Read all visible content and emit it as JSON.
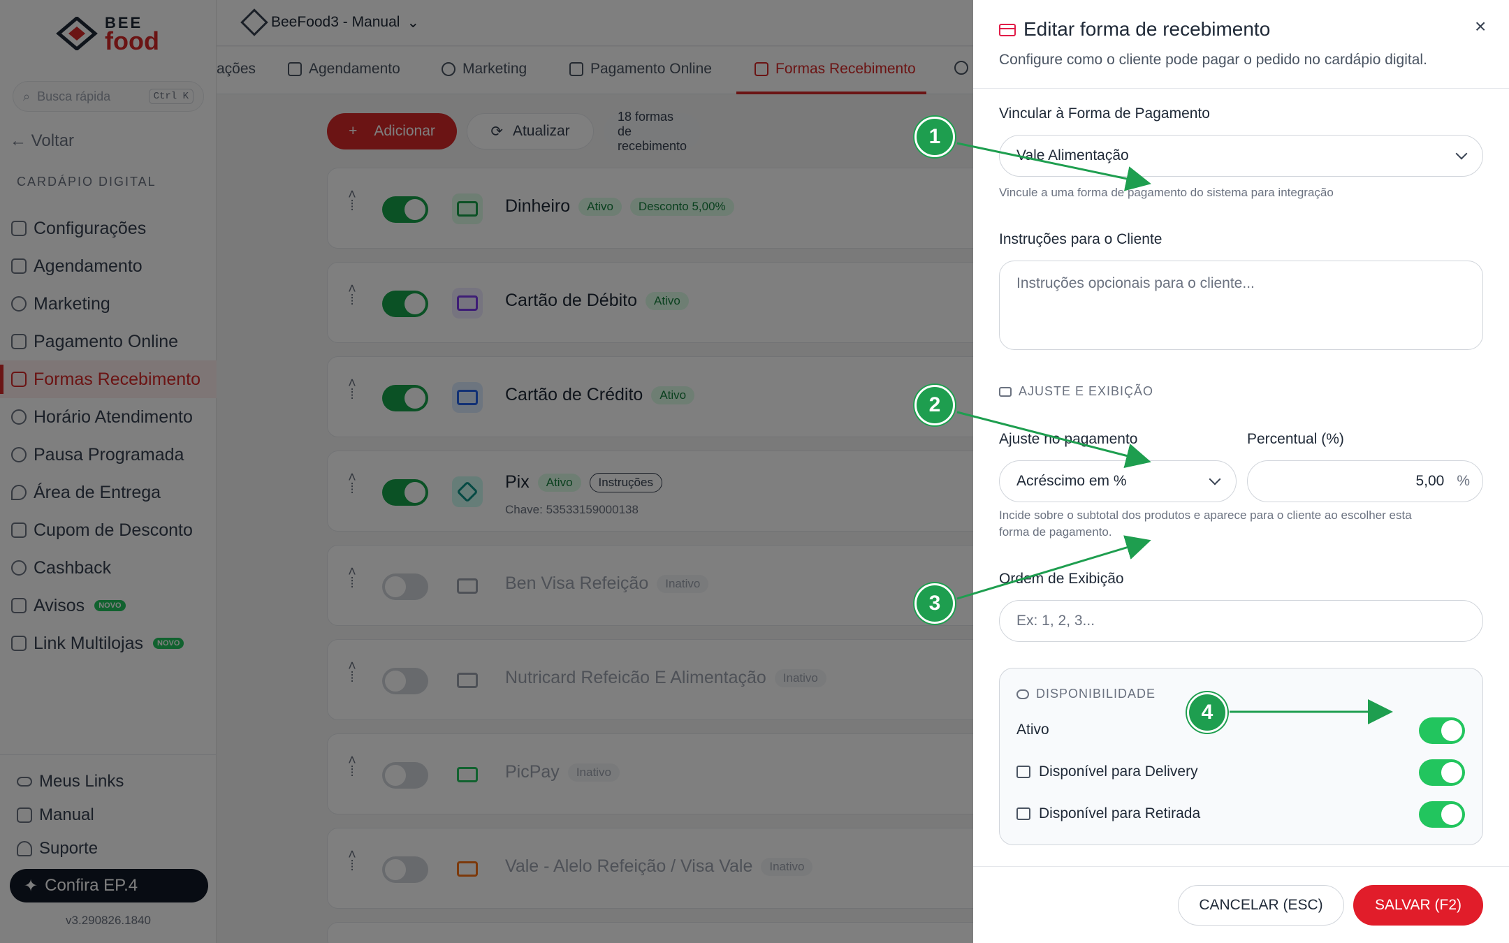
{
  "sidebar": {
    "logo_top": "BEE",
    "logo_bottom": "food",
    "search_placeholder": "Busca rápida",
    "search_shortcut": "Ctrl K",
    "back_label": "Voltar",
    "section_title": "CARDÁPIO DIGITAL",
    "items": [
      {
        "label": "Configurações",
        "icon": "gear-icon"
      },
      {
        "label": "Agendamento",
        "icon": "calendar-icon"
      },
      {
        "label": "Marketing",
        "icon": "target-icon"
      },
      {
        "label": "Pagamento Online",
        "icon": "card-icon"
      },
      {
        "label": "Formas Recebimento",
        "icon": "receipt-icon"
      },
      {
        "label": "Horário Atendimento",
        "icon": "clock-icon"
      },
      {
        "label": "Pausa Programada",
        "icon": "pause-icon"
      },
      {
        "label": "Área de Entrega",
        "icon": "map-pin-icon"
      },
      {
        "label": "Cupom de Desconto",
        "icon": "ticket-icon"
      },
      {
        "label": "Cashback",
        "icon": "coins-icon"
      },
      {
        "label": "Avisos",
        "icon": "megaphone-icon",
        "badge": "NOVO"
      },
      {
        "label": "Link Multilojas",
        "icon": "store-icon",
        "badge": "NOVO"
      }
    ],
    "bottom_items": [
      {
        "label": "Meus Links",
        "icon": "link-icon"
      },
      {
        "label": "Manual",
        "icon": "book-icon"
      },
      {
        "label": "Suporte",
        "icon": "headset-icon"
      }
    ],
    "confira_label": "Confira EP.4",
    "version": "v3.290826.1840"
  },
  "topbar": {
    "store_name": "BeeFood3 - Manual"
  },
  "tabs": [
    {
      "label": "ações",
      "icon": ""
    },
    {
      "label": "Agendamento",
      "icon": "calendar-icon"
    },
    {
      "label": "Marketing",
      "icon": "target-icon"
    },
    {
      "label": "Pagamento Online",
      "icon": "card-icon"
    },
    {
      "label": "Formas Recebimento",
      "icon": "receipt-icon"
    }
  ],
  "toolbar": {
    "add_label": "Adicionar",
    "update_label": "Atualizar",
    "count_label": "18 formas de recebimento"
  },
  "payments": [
    {
      "name": "Dinheiro",
      "status": "Ativo",
      "extra": "Desconto 5,00%",
      "active": true,
      "color": "#16a34a"
    },
    {
      "name": "Cartão de Débito",
      "status": "Ativo",
      "active": true,
      "color": "#7c3aed"
    },
    {
      "name": "Cartão de Crédito",
      "status": "Ativo",
      "active": true,
      "color": "#2563eb"
    },
    {
      "name": "Pix",
      "status": "Ativo",
      "extra": "Instruções",
      "sub": "Chave: 53533159000138",
      "active": true,
      "color": "#0d9488"
    },
    {
      "name": "Ben Visa Refeição",
      "status": "Inativo",
      "active": false,
      "color": "#9ca3af"
    },
    {
      "name": "Nutricard Refeicão E Alimentação",
      "status": "Inativo",
      "active": false,
      "color": "#9ca3af"
    },
    {
      "name": "PicPay",
      "status": "Inativo",
      "active": false,
      "color": "#22c55e"
    },
    {
      "name": "Vale - Alelo Refeição / Visa Vale",
      "status": "Inativo",
      "active": false,
      "color": "#f97316"
    }
  ],
  "drawer": {
    "title": "Editar forma de recebimento",
    "subtitle": "Configure como o cliente pode pagar o pedido no cardápio digital.",
    "link_label": "Vincular à Forma de Pagamento",
    "link_value": "Vale Alimentação",
    "link_hint": "Vincule a uma forma de pagamento do sistema para integração",
    "instructions_label": "Instruções para o Cliente",
    "instructions_placeholder": "Instruções opcionais para o cliente...",
    "adjust_section": "AJUSTE E EXIBIÇÃO",
    "adjust_label": "Ajuste no pagamento",
    "adjust_value": "Acréscimo em %",
    "percent_label": "Percentual (%)",
    "percent_value": "5,00",
    "percent_suffix": "%",
    "adjust_hint_1": "Incide sobre o subtotal dos produtos e aparece para o cliente ao escolher esta",
    "adjust_hint_2": "forma de pagamento.",
    "order_label": "Ordem de Exibição",
    "order_placeholder": "Ex: 1, 2, 3...",
    "availability_section": "DISPONIBILIDADE",
    "active_label": "Ativo",
    "delivery_label": "Disponível para Delivery",
    "pickup_label": "Disponível para Retirada",
    "cancel_label": "CANCELAR (ESC)",
    "save_label": "SALVAR (F2)"
  },
  "markers": [
    "1",
    "2",
    "3",
    "4"
  ],
  "colors": {
    "brand": "#d62828",
    "annotation": "#1e9e4f",
    "toggle_on": "#22c55e"
  }
}
